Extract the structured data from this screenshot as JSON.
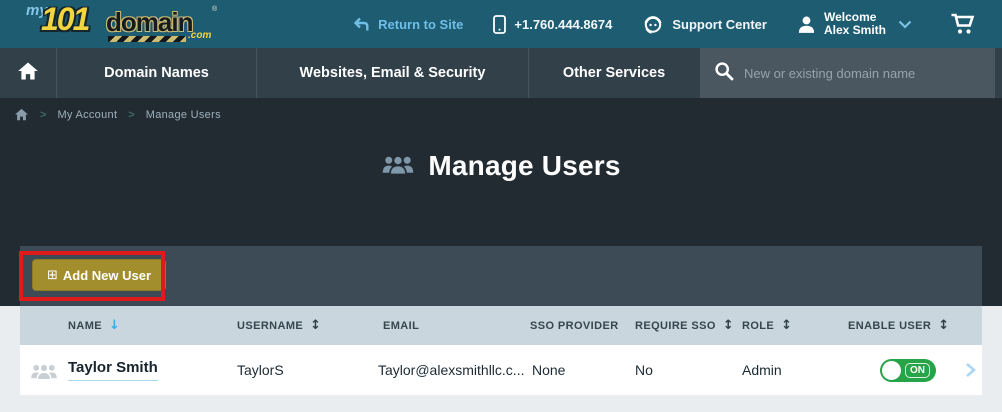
{
  "brand": {
    "my": "my",
    "one01": "101",
    "domain": "domain",
    "tld": ".com",
    "reg": "®"
  },
  "topbar": {
    "return_to_site": "Return to Site",
    "phone": "+1.760.444.8674",
    "support": "Support Center",
    "welcome_line1": "Welcome",
    "welcome_line2": "Alex Smith"
  },
  "nav": {
    "items": [
      "Domain Names",
      "Websites, Email & Security",
      "Other Services"
    ],
    "search_placeholder": "New or existing domain name"
  },
  "breadcrumb": {
    "items": [
      "My Account",
      "Manage Users"
    ],
    "separator": ">"
  },
  "page": {
    "title": "Manage Users"
  },
  "toolbar": {
    "add_new_user": "Add New User",
    "add_icon": "⊞"
  },
  "table": {
    "columns": [
      {
        "label": "NAME",
        "sort": "desc"
      },
      {
        "label": "USERNAME",
        "sort": "both"
      },
      {
        "label": "EMAIL",
        "sort": "none"
      },
      {
        "label": "SSO PROVIDER",
        "sort": "none"
      },
      {
        "label": "REQUIRE SSO",
        "sort": "both"
      },
      {
        "label": "ROLE",
        "sort": "both"
      },
      {
        "label": "ENABLE USER",
        "sort": "both"
      }
    ],
    "rows": [
      {
        "name": "Taylor Smith",
        "username": "TaylorS",
        "email": "Taylor@alexsmithllc.c...",
        "sso_provider": "None",
        "require_sso": "No",
        "role": "Admin",
        "enable_state": "ON"
      }
    ]
  },
  "icons": {
    "sort_down": "↓",
    "sort_both": "↕"
  },
  "colors": {
    "brand_teal": "#1E5C72",
    "nav_dark": "#32404A",
    "search_gray": "#4A5761",
    "page_dark": "#222B31",
    "toolbar_gray": "#3C4B55",
    "gold_button": "#A28E2C",
    "highlight_red": "#E01A1A",
    "table_header_bg": "#C9D6DD",
    "page_light": "#E9EDF0",
    "accent_blue": "#6FBEE6",
    "sort_active_blue": "#3FA9E0",
    "toggle_green": "#27A348"
  }
}
